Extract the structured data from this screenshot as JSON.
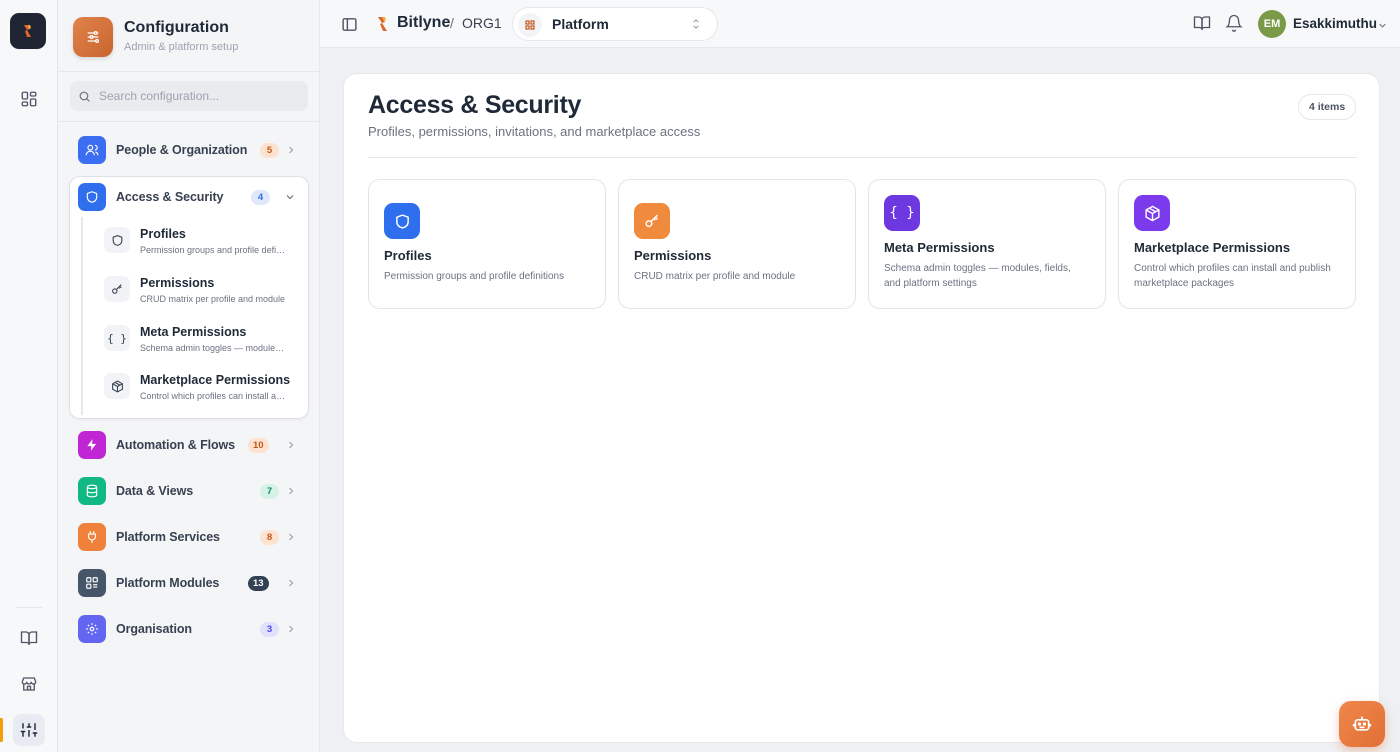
{
  "colors": {
    "accent": "#e07b3c",
    "blue": "#2f6fed",
    "orange": "#f08a3c",
    "violet": "#7c3aed",
    "pink": "#c026d3",
    "green": "#10b981",
    "slate": "#475569",
    "indigo": "#6366f1"
  },
  "panel": {
    "title": "Configuration",
    "subtitle": "Admin & platform setup",
    "search_placeholder": "Search configuration...",
    "categories": [
      {
        "label": "People & Organization",
        "count": "5",
        "icon": "users-icon"
      },
      {
        "label": "Access & Security",
        "count": "4",
        "icon": "shield-icon",
        "expanded": true
      },
      {
        "label": "Automation & Flows",
        "count": "10",
        "icon": "zap-icon"
      },
      {
        "label": "Data & Views",
        "count": "7",
        "icon": "database-icon"
      },
      {
        "label": "Platform Services",
        "count": "8",
        "icon": "plug-icon"
      },
      {
        "label": "Platform Modules",
        "count": "13",
        "icon": "grid-icon"
      },
      {
        "label": "Organisation",
        "count": "3",
        "icon": "gear-icon"
      }
    ],
    "subitems": [
      {
        "title": "Profiles",
        "desc": "Permission groups and profile definitions"
      },
      {
        "title": "Permissions",
        "desc": "CRUD matrix per profile and module"
      },
      {
        "title": "Meta Permissions",
        "desc": "Schema admin toggles — modules, fields, and platform settings"
      },
      {
        "title": "Marketplace Permissions",
        "desc": "Control which profiles can install and publish marketplace packages"
      }
    ]
  },
  "topbar": {
    "brand": "Bitlyne",
    "separator": "/",
    "org": "ORG1",
    "app_select": "Platform",
    "user_initials": "EM",
    "user_name": "Esakkimuthu"
  },
  "main": {
    "title": "Access & Security",
    "subtitle": "Profiles, permissions, invitations, and marketplace access",
    "count_badge": "4 items",
    "cards": [
      {
        "title": "Profiles",
        "desc": "Permission groups and profile definitions",
        "icon": "shield-icon"
      },
      {
        "title": "Permissions",
        "desc": "CRUD matrix per profile and module",
        "icon": "key-icon"
      },
      {
        "title": "Meta Permissions",
        "desc": "Schema admin toggles — modules, fields, and platform settings",
        "icon": "braces-icon"
      },
      {
        "title": "Marketplace Permissions",
        "desc": "Control which profiles can install and publish marketplace packages",
        "icon": "package-icon"
      }
    ]
  }
}
